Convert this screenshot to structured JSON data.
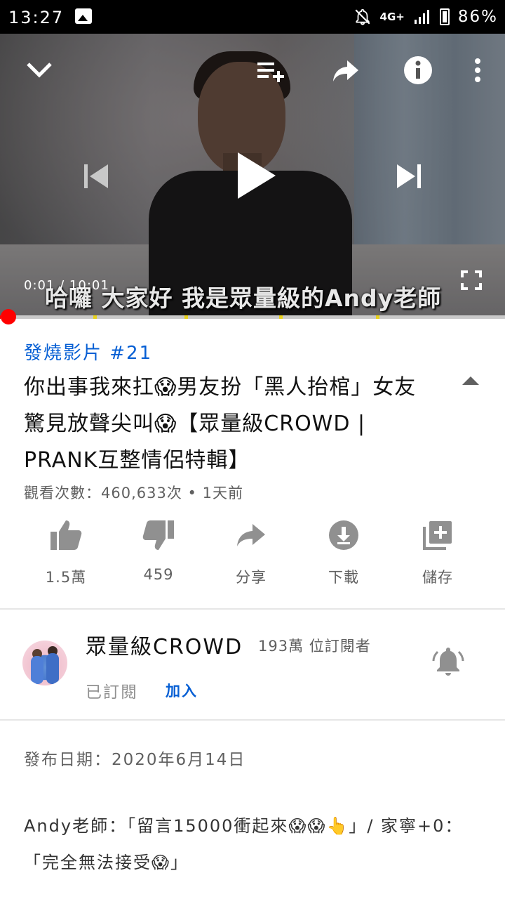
{
  "status_bar": {
    "time": "13:27",
    "network": "4G+",
    "battery": "86%"
  },
  "player": {
    "subtitle": "哈囉 大家好 我是眾量級的Andy老師",
    "timecode": "0:01 / 10:01",
    "progress_fraction": 0.002
  },
  "video": {
    "hashtag": "發燒影片 #21",
    "title": "你出事我來扛😱男友扮「黑人抬棺」女友驚見放聲尖叫😱【眾量級CROWD | PRANK互整情侶特輯】",
    "views": "觀看次數：460,633次 • 1天前"
  },
  "actions": [
    {
      "label": "1.5萬",
      "icon": "thumb-up-icon"
    },
    {
      "label": "459",
      "icon": "thumb-down-icon"
    },
    {
      "label": "分享",
      "icon": "share-icon"
    },
    {
      "label": "下載",
      "icon": "download-icon"
    },
    {
      "label": "儲存",
      "icon": "add-to-library-icon"
    }
  ],
  "channel": {
    "name": "眾量級CROWD",
    "subscribers": "193萬 位訂閱者",
    "subscribed_label": "已訂閱",
    "join_label": "加入"
  },
  "description": {
    "date": "發布日期：2020年6月14日",
    "body": "Andy老師：「留言15000衝起來😱😱👆」/ 家寧+0：「完全無法接受😱」"
  },
  "colors": {
    "accent_link": "#065fd4",
    "progress_played": "#ff0000",
    "icon_gray": "#909090"
  }
}
